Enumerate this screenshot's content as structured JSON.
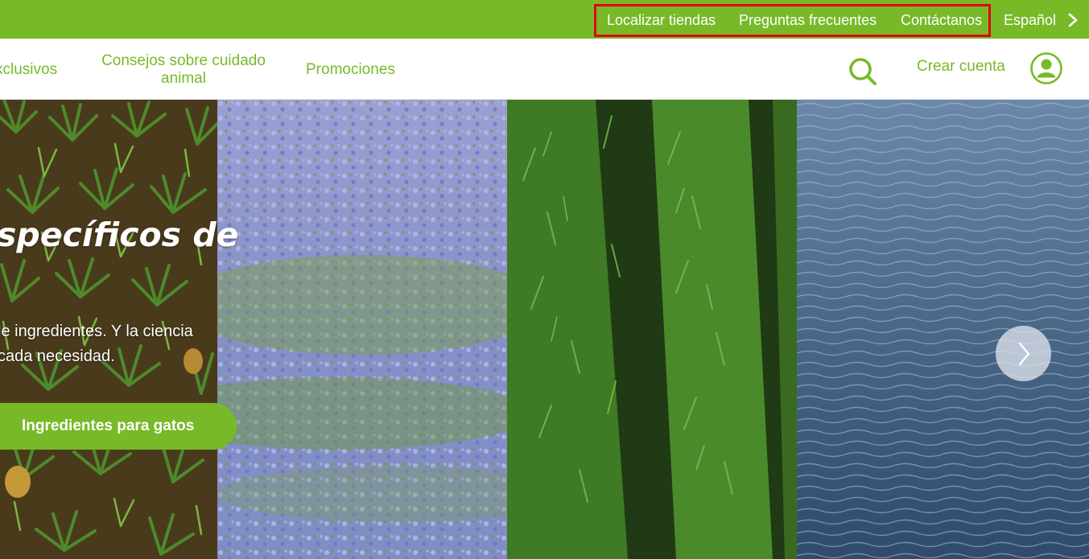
{
  "utility_nav": {
    "links": [
      "Localizar tiendas",
      "Preguntas frecuentes",
      "Contáctanos"
    ],
    "language": "Español",
    "language_icon": "chevron-right-icon"
  },
  "main_nav": {
    "items": [
      "xclusivos",
      "Consejos sobre cuidado animal",
      "Promociones"
    ],
    "search_icon": "search-icon",
    "create_account": "Crear cuenta",
    "account_icon": "user-account-icon"
  },
  "hero": {
    "title": "specíficos de",
    "body_lines": [
      "le ingredientes. Y la ciencia",
      "cada necesidad."
    ],
    "cta": "Ingredientes para gatos",
    "next_icon": "chevron-right-icon"
  },
  "colors": {
    "brand_green": "#78b928",
    "highlight_red": "#e3000f"
  }
}
